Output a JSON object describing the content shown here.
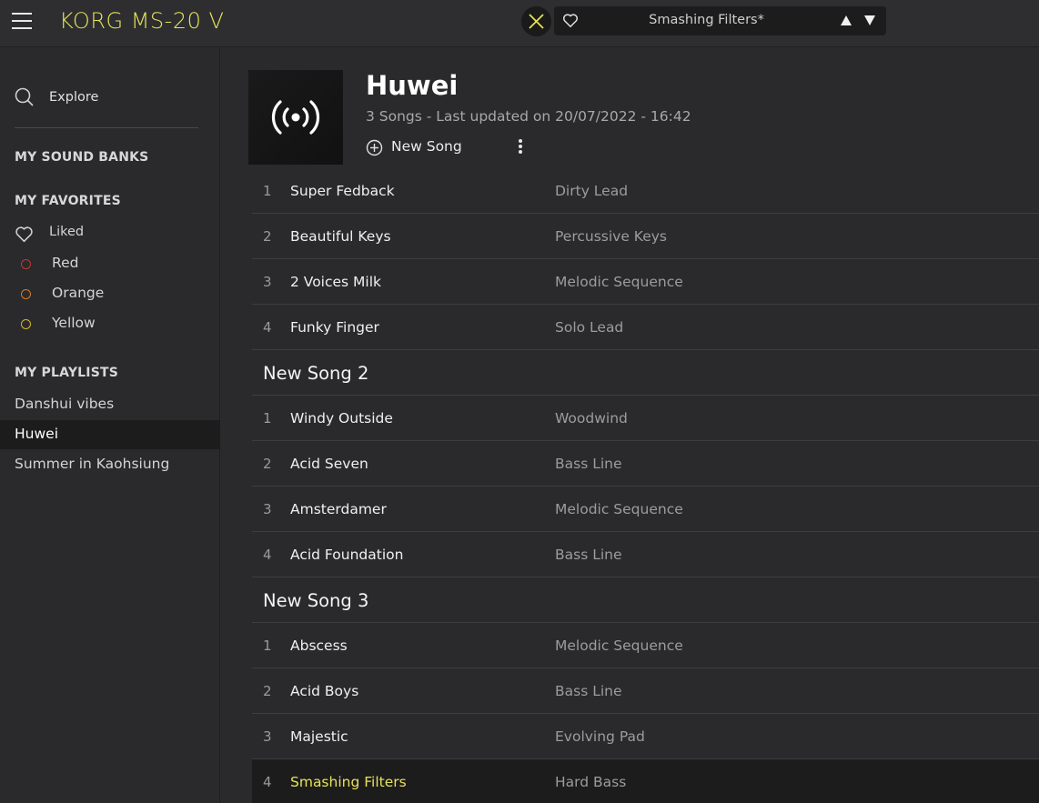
{
  "app": {
    "title": "KORG MS-20 V"
  },
  "toolbar": {
    "preset_name": "Smashing Filters*"
  },
  "colors": {
    "accent": "#e6e25a",
    "red": "#c0392b",
    "orange": "#d4792a",
    "yellow": "#d9b62a"
  },
  "sidebar": {
    "explore_label": "Explore",
    "sound_banks_heading": "MY SOUND BANKS",
    "favorites_heading": "MY FAVORITES",
    "favorites": [
      {
        "label": "Liked",
        "icon": "heart-icon"
      },
      {
        "label": "Red",
        "icon": "red-dot-icon"
      },
      {
        "label": "Orange",
        "icon": "orange-dot-icon"
      },
      {
        "label": "Yellow",
        "icon": "yellow-dot-icon"
      }
    ],
    "playlists_heading": "MY PLAYLISTS",
    "playlists": [
      {
        "label": "Danshui vibes"
      },
      {
        "label": "Huwei",
        "active": true
      },
      {
        "label": "Summer in Kaohsiung"
      }
    ]
  },
  "playlist": {
    "title": "Huwei",
    "meta": "3 Songs - Last updated on 20/07/2022 - 16:42",
    "new_song_label": "New Song",
    "cover_icon": "broadcast-icon"
  },
  "songs": [
    {
      "title": "",
      "presets": [
        {
          "num": "1",
          "name": "Super Fedback",
          "type": "Dirty Lead"
        },
        {
          "num": "2",
          "name": "Beautiful Keys",
          "type": "Percussive Keys"
        },
        {
          "num": "3",
          "name": "2 Voices Milk",
          "type": "Melodic Sequence"
        },
        {
          "num": "4",
          "name": "Funky Finger",
          "type": "Solo Lead"
        }
      ]
    },
    {
      "title": "New Song 2",
      "presets": [
        {
          "num": "1",
          "name": "Windy Outside",
          "type": "Woodwind"
        },
        {
          "num": "2",
          "name": "Acid Seven",
          "type": "Bass Line"
        },
        {
          "num": "3",
          "name": "Amsterdamer",
          "type": "Melodic Sequence"
        },
        {
          "num": "4",
          "name": "Acid Foundation",
          "type": "Bass Line"
        }
      ]
    },
    {
      "title": "New Song 3",
      "presets": [
        {
          "num": "1",
          "name": "Abscess",
          "type": "Melodic Sequence"
        },
        {
          "num": "2",
          "name": "Acid Boys",
          "type": "Bass Line"
        },
        {
          "num": "3",
          "name": "Majestic",
          "type": "Evolving Pad"
        },
        {
          "num": "4",
          "name": "Smashing Filters",
          "type": "Hard Bass",
          "selected": true
        }
      ]
    }
  ]
}
